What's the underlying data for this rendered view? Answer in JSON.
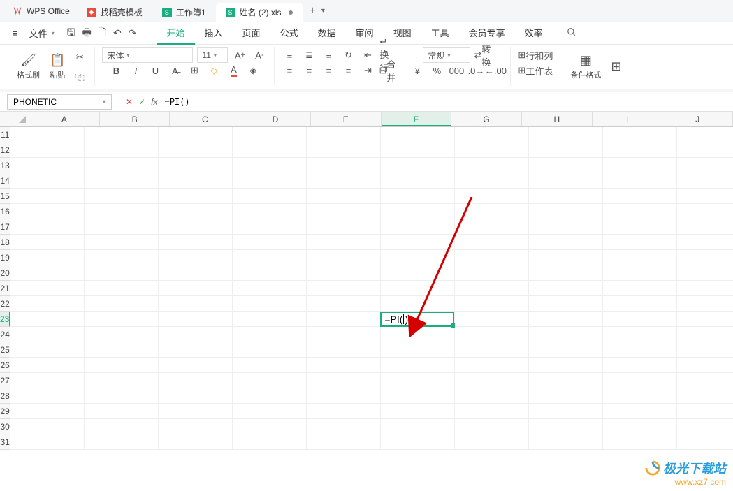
{
  "title_bar": {
    "app_name": "WPS Office",
    "tabs": [
      {
        "label": "找稻壳模板",
        "icon_bg": "#e74c3c",
        "icon_text": ""
      },
      {
        "label": "工作簿1",
        "icon_bg": "#1aad7f",
        "icon_text": "S"
      },
      {
        "label": "姓名 (2).xls",
        "icon_bg": "#1aad7f",
        "icon_text": "S",
        "active": true,
        "modified": true
      }
    ],
    "add": "+"
  },
  "menu": {
    "file": "文件",
    "items": [
      "开始",
      "插入",
      "页面",
      "公式",
      "数据",
      "审阅",
      "视图",
      "工具",
      "会员专享",
      "效率"
    ],
    "active_index": 0
  },
  "ribbon": {
    "group_clipboard": {
      "format_painter": "格式刷",
      "paste": "粘贴"
    },
    "font": {
      "name": "宋体",
      "size": "11"
    },
    "number": {
      "format": "常规"
    },
    "convert": "转换",
    "rows_cols": "行和列",
    "worksheet": "工作表",
    "cond_format": "条件格式",
    "merge": "合并"
  },
  "formula_bar": {
    "name_box": "PHONETIC",
    "fx": "fx",
    "formula": "=PI()"
  },
  "grid": {
    "cols": [
      "A",
      "B",
      "C",
      "D",
      "E",
      "F",
      "G",
      "H",
      "I",
      "J"
    ],
    "row_start": 11,
    "row_end": 31,
    "active_col": "F",
    "active_row": 23,
    "active_cell_value": "=PI()",
    "active_cell_display_prefix": "=PI(",
    "active_cell_display_suffix": ")"
  },
  "watermark": {
    "main": "极光下载站",
    "url": "www.xz7.com"
  }
}
